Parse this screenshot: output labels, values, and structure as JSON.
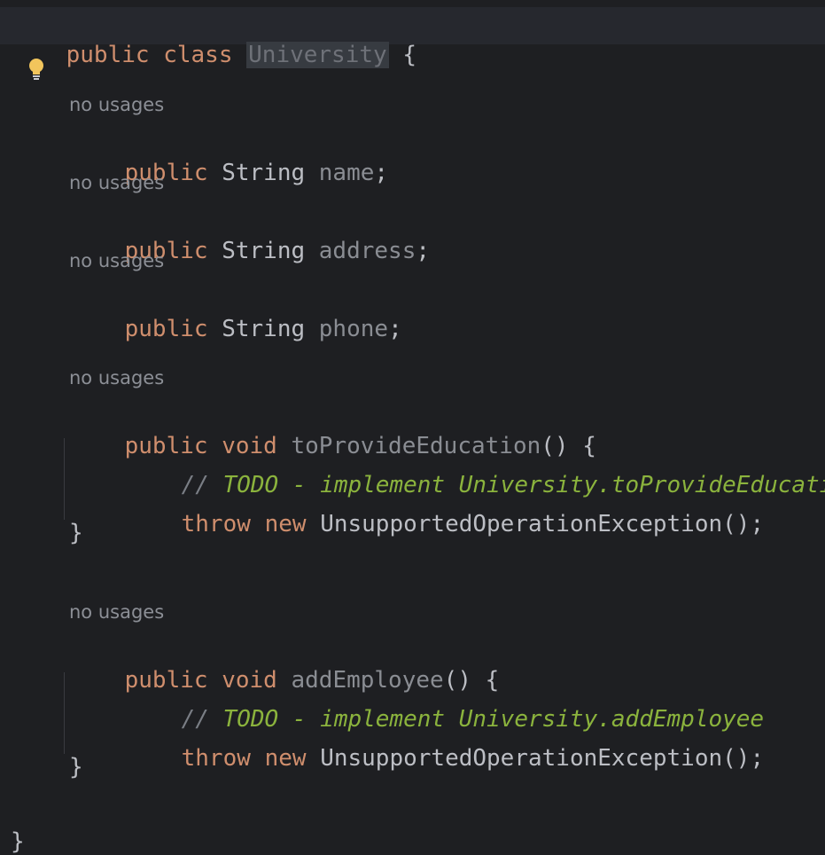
{
  "code": {
    "class_decl": {
      "modifier": "public",
      "keyword": "class",
      "name": "University",
      "open": " {"
    },
    "hint": "no usages",
    "fields": [
      {
        "modifier": "public",
        "type": "String",
        "name": "name",
        "end": ";"
      },
      {
        "modifier": "public",
        "type": "String",
        "name": "address",
        "end": ";"
      },
      {
        "modifier": "public",
        "type": "String",
        "name": "phone",
        "end": ";"
      }
    ],
    "methods": [
      {
        "modifier": "public",
        "ret": "void",
        "name": "toProvideEducation",
        "sig_end": "() {",
        "comment_slashes": "//",
        "todo": "TODO - implement University.toProvideEducation",
        "throw_kw": "throw",
        "new_kw": "new",
        "exception": "UnsupportedOperationException();",
        "close": "}"
      },
      {
        "modifier": "public",
        "ret": "void",
        "name": "addEmployee",
        "sig_end": "() {",
        "comment_slashes": "//",
        "todo": "TODO - implement University.addEmployee",
        "throw_kw": "throw",
        "new_kw": "new",
        "exception": "UnsupportedOperationException();",
        "close": "}"
      }
    ],
    "class_close": "}"
  },
  "icons": {
    "bulb": "lightbulb-icon",
    "bulb_color": "#f2c55c"
  },
  "colors": {
    "background": "#1e1f22",
    "keyword": "#cf8e6d",
    "todo": "#8bb33d"
  }
}
